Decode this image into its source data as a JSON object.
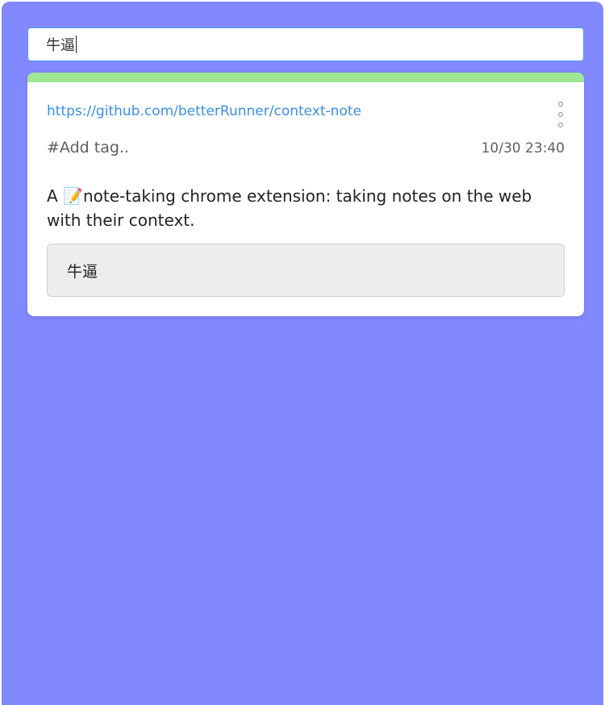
{
  "search": {
    "value": "牛逼"
  },
  "card": {
    "accent_color": "#9ee692",
    "url": "https://github.com/betterRunner/context-note",
    "tag_placeholder": "#Add tag..",
    "timestamp": "10/30 23:40",
    "description_prefix": "A ",
    "description_icon": "📝",
    "description_text": "note-taking chrome extension: taking notes on the web with their context.",
    "note": "牛逼",
    "menu_icon": "more-vertical-icon"
  },
  "colors": {
    "background": "#8289ff",
    "link": "#3a8ee6",
    "search_border": "#4a9bff"
  }
}
